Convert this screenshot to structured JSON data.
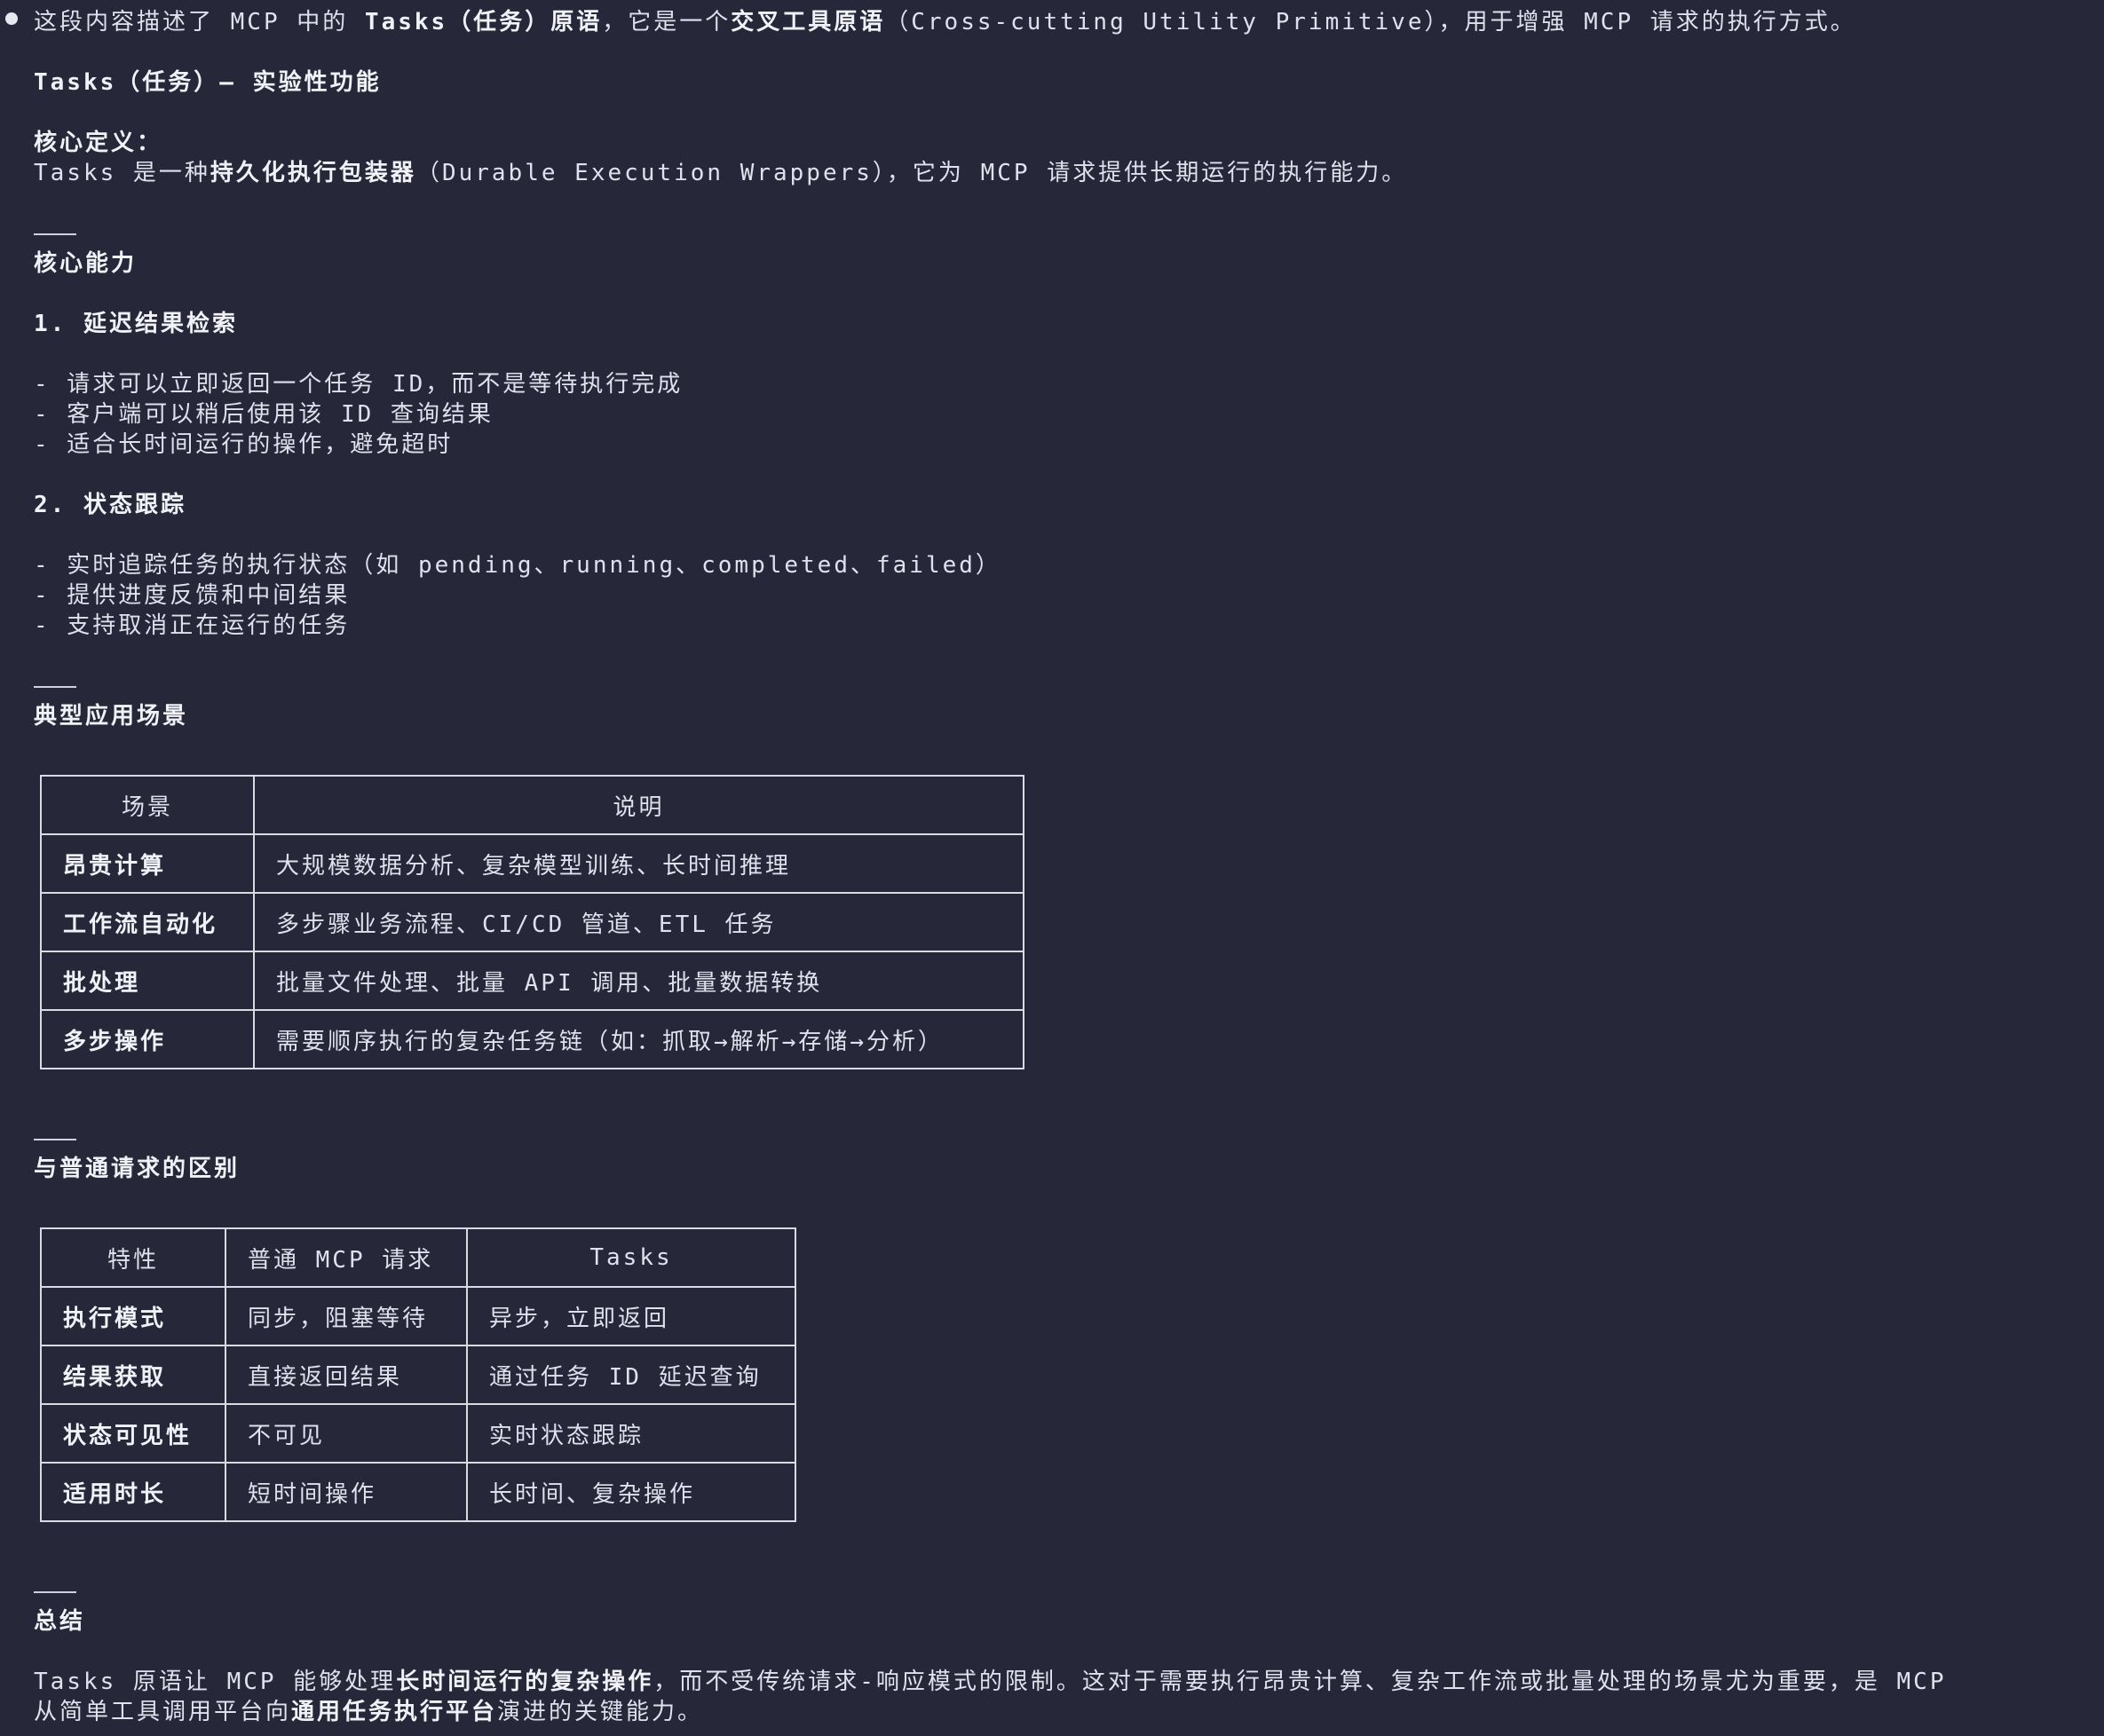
{
  "intro": {
    "p1": "这段内容描述了 MCP 中的 ",
    "b1": "Tasks（任务）原语",
    "p2": "，它是一个",
    "b2": "交叉工具原语",
    "p3": "（Cross-cutting Utility Primitive），用于增强 MCP 请求的执行方式。"
  },
  "title": "Tasks（任务）— 实验性功能",
  "core_def": {
    "heading": "核心定义：",
    "p1": "Tasks 是一种",
    "b1": "持久化执行包装器",
    "p2": "（Durable Execution Wrappers），它为 MCP 请求提供长期运行的执行能力。"
  },
  "core_abilities": {
    "heading": "核心能力",
    "s1_title": "1. 延迟结果检索",
    "s1_items": [
      "- 请求可以立即返回一个任务 ID，而不是等待执行完成",
      "- 客户端可以稍后使用该 ID 查询结果",
      "- 适合长时间运行的操作，避免超时"
    ],
    "s2_title": "2. 状态跟踪",
    "s2_items": [
      "- 实时追踪任务的执行状态（如 pending、running、completed、failed）",
      "- 提供进度反馈和中间结果",
      "- 支持取消正在运行的任务"
    ]
  },
  "scenarios": {
    "heading": "典型应用场景",
    "headers": [
      "场景",
      "说明"
    ],
    "rows": [
      [
        "昂贵计算",
        "大规模数据分析、复杂模型训练、长时间推理"
      ],
      [
        "工作流自动化",
        "多步骤业务流程、CI/CD 管道、ETL 任务"
      ],
      [
        "批处理",
        "批量文件处理、批量 API 调用、批量数据转换"
      ],
      [
        "多步操作",
        "需要顺序执行的复杂任务链（如：抓取→解析→存储→分析）"
      ]
    ]
  },
  "comparison": {
    "heading": "与普通请求的区别",
    "headers": [
      "特性",
      "普通 MCP 请求",
      "Tasks"
    ],
    "rows": [
      [
        "执行模式",
        "同步，阻塞等待",
        "异步，立即返回"
      ],
      [
        "结果获取",
        "直接返回结果",
        "通过任务 ID 延迟查询"
      ],
      [
        "状态可见性",
        "不可见",
        "实时状态跟踪"
      ],
      [
        "适用时长",
        "短时间操作",
        "长时间、复杂操作"
      ]
    ]
  },
  "summary": {
    "heading": "总结",
    "l1_p1": "Tasks 原语让 MCP 能够处理",
    "l1_b1": "长时间运行的复杂操作",
    "l1_p2": "，而不受传统请求-响应模式的限制。这对于需要执行昂贵计算、复杂工作流或批量处理的场景尤为重要，是 MCP",
    "l2_p1": "从简单工具调用平台向",
    "l2_b1": "通用任务执行平台",
    "l2_p2": "演进的关键能力。"
  },
  "separator": "---",
  "colors": {
    "background": "#262739",
    "text": "#dfe1ec",
    "border": "#d8dae4"
  }
}
